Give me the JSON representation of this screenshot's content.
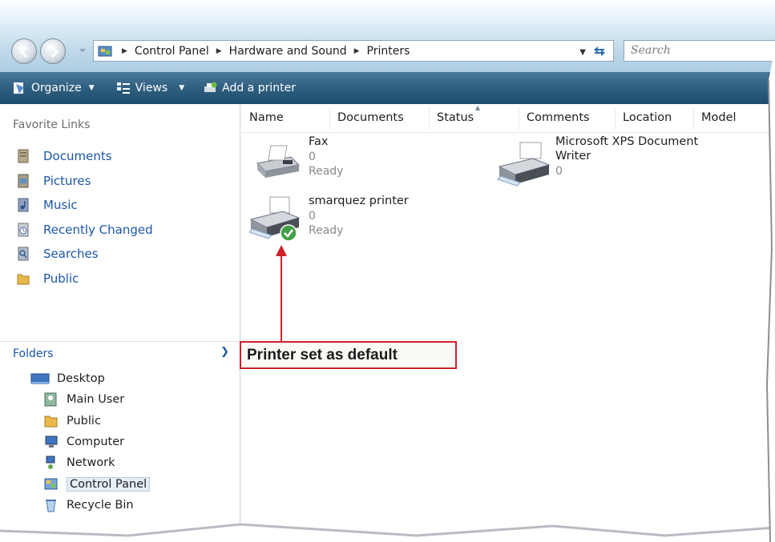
{
  "address": {
    "crumbs": [
      "Control Panel",
      "Hardware and Sound",
      "Printers"
    ],
    "search_placeholder": "Search"
  },
  "toolbar": {
    "organize": "Organize",
    "views": "Views",
    "add_printer": "Add a printer"
  },
  "sidebar": {
    "favorites_title": "Favorite Links",
    "favorites": [
      "Documents",
      "Pictures",
      "Music",
      "Recently Changed",
      "Searches",
      "Public"
    ],
    "folders_title": "Folders",
    "tree": [
      {
        "label": "Desktop"
      },
      {
        "label": "Main User"
      },
      {
        "label": "Public"
      },
      {
        "label": "Computer"
      },
      {
        "label": "Network"
      },
      {
        "label": "Control Panel"
      },
      {
        "label": "Recycle Bin"
      }
    ]
  },
  "columns": [
    "Name",
    "Documents",
    "Status",
    "Comments",
    "Location",
    "Model"
  ],
  "printers": [
    {
      "name": "Fax",
      "documents": "0",
      "status": "Ready"
    },
    {
      "name": "Microsoft XPS Document Writer",
      "name_line1": "Microsoft XPS Document",
      "name_line2": "Writer",
      "documents": "0"
    },
    {
      "name": "smarquez printer",
      "documents": "0",
      "status": "Ready",
      "default": true
    }
  ],
  "callout": "Printer set as default",
  "colors": {
    "toolbar": "#2f5f80",
    "link": "#1c55a6",
    "callout": "#d0202a"
  }
}
